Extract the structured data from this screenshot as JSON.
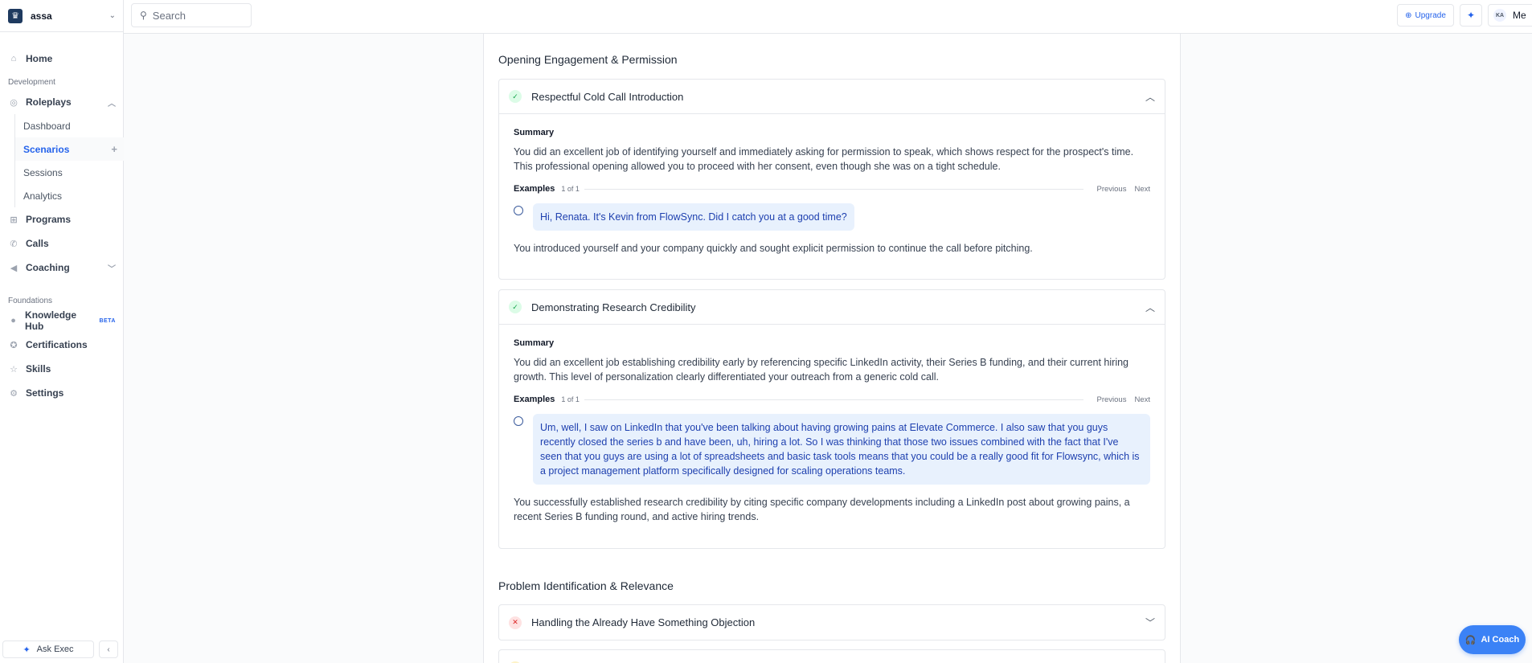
{
  "workspace": {
    "name": "assa"
  },
  "search": {
    "placeholder": "Search"
  },
  "header": {
    "upgrade_label": "Upgrade",
    "avatar_initials": "KA",
    "me_label": "Me"
  },
  "sidebar": {
    "home": "Home",
    "development_label": "Development",
    "roleplays": "Roleplays",
    "roleplays_sub": [
      "Dashboard",
      "Scenarios",
      "Sessions",
      "Analytics"
    ],
    "programs": "Programs",
    "calls": "Calls",
    "coaching": "Coaching",
    "foundations_label": "Foundations",
    "knowledge_hub": "Knowledge Hub",
    "beta_badge": "BETA",
    "certifications": "Certifications",
    "skills": "Skills",
    "settings": "Settings",
    "ask_exec": "Ask Exec"
  },
  "sections": [
    {
      "title": "Opening Engagement & Permission",
      "cards": [
        {
          "title": "Respectful Cold Call Introduction",
          "status": "pass",
          "summary_label": "Summary",
          "summary": "You did an excellent job of identifying yourself and immediately asking for permission to speak, which shows respect for the prospect's time. This professional opening allowed you to proceed with her consent, even though she was on a tight schedule.",
          "examples_label": "Examples",
          "examples_count": "1 of 1",
          "prev_label": "Previous",
          "next_label": "Next",
          "quote": "Hi, Renata. It's Kevin from FlowSync. Did I catch you at a good time?",
          "explanation": "You introduced yourself and your company quickly and sought explicit permission to continue the call before pitching."
        },
        {
          "title": "Demonstrating Research Credibility",
          "status": "pass",
          "summary_label": "Summary",
          "summary": "You did an excellent job establishing credibility early by referencing specific LinkedIn activity, their Series B funding, and their current hiring growth. This level of personalization clearly differentiated your outreach from a generic cold call.",
          "examples_label": "Examples",
          "examples_count": "1 of 1",
          "prev_label": "Previous",
          "next_label": "Next",
          "quote": "Um, well, I saw on LinkedIn that you've been talking about having growing pains at Elevate Commerce. I also saw that you guys recently closed the series b and have been, uh, hiring a lot. So I was thinking that those two issues combined with the fact that I've seen that you guys are using a lot of spreadsheets and basic task tools means that you could be a really good fit for Flowsync, which is a project management platform specifically designed for scaling operations teams.",
          "explanation": "You successfully established research credibility by citing specific company developments including a LinkedIn post about growing pains, a recent Series B funding round, and active hiring trends."
        }
      ]
    },
    {
      "title": "Problem Identification & Relevance",
      "cards": [
        {
          "title": "Handling the Already Have Something Objection",
          "status": "fail"
        },
        {
          "title": "",
          "status": "warn"
        }
      ]
    }
  ],
  "ai_coach": "AI Coach"
}
